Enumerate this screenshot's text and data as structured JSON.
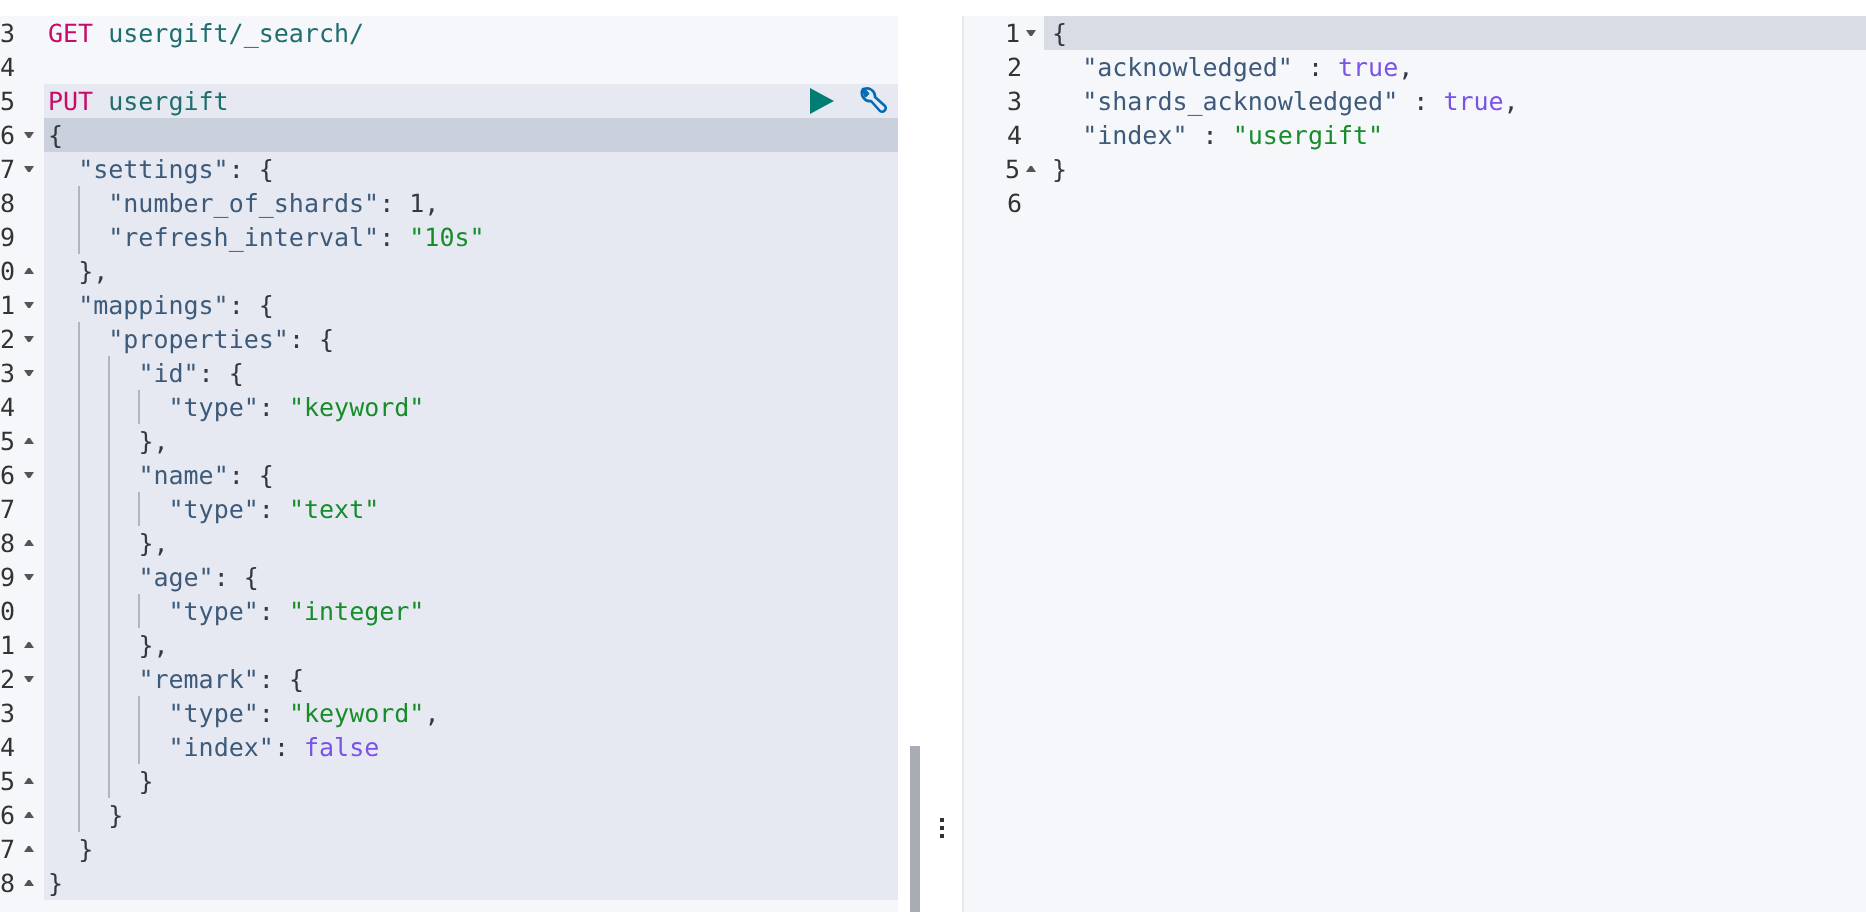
{
  "request_pane": {
    "lines": [
      {
        "number": "3",
        "kind": "plain",
        "selected": false,
        "active": false,
        "tokens": [
          {
            "kind": "method",
            "text": "GET"
          },
          {
            "kind": "url",
            "text": " usergift/_search/"
          }
        ]
      },
      {
        "number": "4",
        "kind": "plain",
        "selected": false,
        "active": false
      },
      {
        "number": "5",
        "kind": "plain",
        "selected": true,
        "active": false,
        "tokens": [
          {
            "kind": "method",
            "text": "PUT"
          },
          {
            "kind": "url",
            "text": " usergift"
          }
        ]
      },
      {
        "number": "6",
        "kind": "opener",
        "selected": true,
        "active": true,
        "tokens": [
          {
            "kind": "punct",
            "text": "{"
          }
        ]
      },
      {
        "number": "7",
        "kind": "opener",
        "selected": true,
        "active": false,
        "tokens": [
          {
            "kind": "key",
            "text": "  \"settings\""
          },
          {
            "kind": "punct",
            "text": ": {"
          }
        ]
      },
      {
        "number": "8",
        "kind": "plain",
        "selected": true,
        "active": false,
        "tokens": [
          {
            "kind": "key",
            "text": "    \"number_of_shards\""
          },
          {
            "kind": "punct",
            "text": ": 1,"
          }
        ]
      },
      {
        "number": "9",
        "kind": "plain",
        "selected": true,
        "active": false,
        "tokens": [
          {
            "kind": "key",
            "text": "    \"refresh_interval\""
          },
          {
            "kind": "punct",
            "text": ": "
          },
          {
            "kind": "string",
            "text": "\"10s\""
          }
        ]
      },
      {
        "number": "0",
        "kind": "closer",
        "selected": true,
        "active": false,
        "tokens": [
          {
            "kind": "punct",
            "text": "  },"
          }
        ]
      },
      {
        "number": "1",
        "kind": "opener",
        "selected": true,
        "active": false,
        "tokens": [
          {
            "kind": "key",
            "text": "  \"mappings\""
          },
          {
            "kind": "punct",
            "text": ": {"
          }
        ]
      },
      {
        "number": "2",
        "kind": "opener",
        "selected": true,
        "active": false,
        "tokens": [
          {
            "kind": "key",
            "text": "    \"properties\""
          },
          {
            "kind": "punct",
            "text": ": {"
          }
        ]
      },
      {
        "number": "3",
        "kind": "opener",
        "selected": true,
        "active": false,
        "tokens": [
          {
            "kind": "key",
            "text": "      \"id\""
          },
          {
            "kind": "punct",
            "text": ": {"
          }
        ]
      },
      {
        "number": "4",
        "kind": "plain",
        "selected": true,
        "active": false,
        "tokens": [
          {
            "kind": "key",
            "text": "        \"type\""
          },
          {
            "kind": "punct",
            "text": ": "
          },
          {
            "kind": "string",
            "text": "\"keyword\""
          }
        ]
      },
      {
        "number": "5",
        "kind": "closer",
        "selected": true,
        "active": false,
        "tokens": [
          {
            "kind": "punct",
            "text": "      },"
          }
        ]
      },
      {
        "number": "6",
        "kind": "opener",
        "selected": true,
        "active": false,
        "tokens": [
          {
            "kind": "key",
            "text": "      \"name\""
          },
          {
            "kind": "punct",
            "text": ": {"
          }
        ]
      },
      {
        "number": "7",
        "kind": "plain",
        "selected": true,
        "active": false,
        "tokens": [
          {
            "kind": "key",
            "text": "        \"type\""
          },
          {
            "kind": "punct",
            "text": ": "
          },
          {
            "kind": "string",
            "text": "\"text\""
          }
        ]
      },
      {
        "number": "8",
        "kind": "closer",
        "selected": true,
        "active": false,
        "tokens": [
          {
            "kind": "punct",
            "text": "      },"
          }
        ]
      },
      {
        "number": "9",
        "kind": "opener",
        "selected": true,
        "active": false,
        "tokens": [
          {
            "kind": "key",
            "text": "      \"age\""
          },
          {
            "kind": "punct",
            "text": ": {"
          }
        ]
      },
      {
        "number": "0",
        "kind": "plain",
        "selected": true,
        "active": false,
        "tokens": [
          {
            "kind": "key",
            "text": "        \"type\""
          },
          {
            "kind": "punct",
            "text": ": "
          },
          {
            "kind": "string",
            "text": "\"integer\""
          }
        ]
      },
      {
        "number": "1",
        "kind": "closer",
        "selected": true,
        "active": false,
        "tokens": [
          {
            "kind": "punct",
            "text": "      },"
          }
        ]
      },
      {
        "number": "2",
        "kind": "opener",
        "selected": true,
        "active": false,
        "tokens": [
          {
            "kind": "key",
            "text": "      \"remark\""
          },
          {
            "kind": "punct",
            "text": ": {"
          }
        ]
      },
      {
        "number": "3",
        "kind": "plain",
        "selected": true,
        "active": false,
        "tokens": [
          {
            "kind": "key",
            "text": "        \"type\""
          },
          {
            "kind": "punct",
            "text": ": "
          },
          {
            "kind": "string",
            "text": "\"keyword\""
          },
          {
            "kind": "punct",
            "text": ","
          }
        ]
      },
      {
        "number": "4",
        "kind": "plain",
        "selected": true,
        "active": false,
        "tokens": [
          {
            "kind": "key",
            "text": "        \"index\""
          },
          {
            "kind": "punct",
            "text": ": "
          },
          {
            "kind": "bool",
            "text": "false"
          }
        ]
      },
      {
        "number": "5",
        "kind": "closer",
        "selected": true,
        "active": false,
        "tokens": [
          {
            "kind": "punct",
            "text": "      }"
          }
        ]
      },
      {
        "number": "6",
        "kind": "closer",
        "selected": true,
        "active": false,
        "tokens": [
          {
            "kind": "punct",
            "text": "    }"
          }
        ]
      },
      {
        "number": "7",
        "kind": "closer",
        "selected": true,
        "active": false,
        "tokens": [
          {
            "kind": "punct",
            "text": "  }"
          }
        ]
      },
      {
        "number": "8",
        "kind": "closer",
        "selected": true,
        "active": false,
        "tokens": [
          {
            "kind": "punct",
            "text": "}"
          }
        ]
      }
    ]
  },
  "response_pane": {
    "lines": [
      {
        "number": "1",
        "kind": "opener",
        "active": true,
        "tokens": [
          {
            "kind": "punct",
            "text": "{"
          }
        ]
      },
      {
        "number": "2",
        "kind": "plain",
        "active": false,
        "tokens": [
          {
            "kind": "key",
            "text": "  \"acknowledged\""
          },
          {
            "kind": "punct",
            "text": " : "
          },
          {
            "kind": "bool",
            "text": "true"
          },
          {
            "kind": "punct",
            "text": ","
          }
        ]
      },
      {
        "number": "3",
        "kind": "plain",
        "active": false,
        "tokens": [
          {
            "kind": "key",
            "text": "  \"shards_acknowledged\""
          },
          {
            "kind": "punct",
            "text": " : "
          },
          {
            "kind": "bool",
            "text": "true"
          },
          {
            "kind": "punct",
            "text": ","
          }
        ]
      },
      {
        "number": "4",
        "kind": "plain",
        "active": false,
        "tokens": [
          {
            "kind": "key",
            "text": "  \"index\""
          },
          {
            "kind": "punct",
            "text": " : "
          },
          {
            "kind": "string",
            "text": "\"usergift\""
          }
        ]
      },
      {
        "number": "5",
        "kind": "closer",
        "active": false,
        "tokens": [
          {
            "kind": "punct",
            "text": "}"
          }
        ]
      },
      {
        "number": "6",
        "kind": "plain",
        "active": false
      }
    ]
  }
}
